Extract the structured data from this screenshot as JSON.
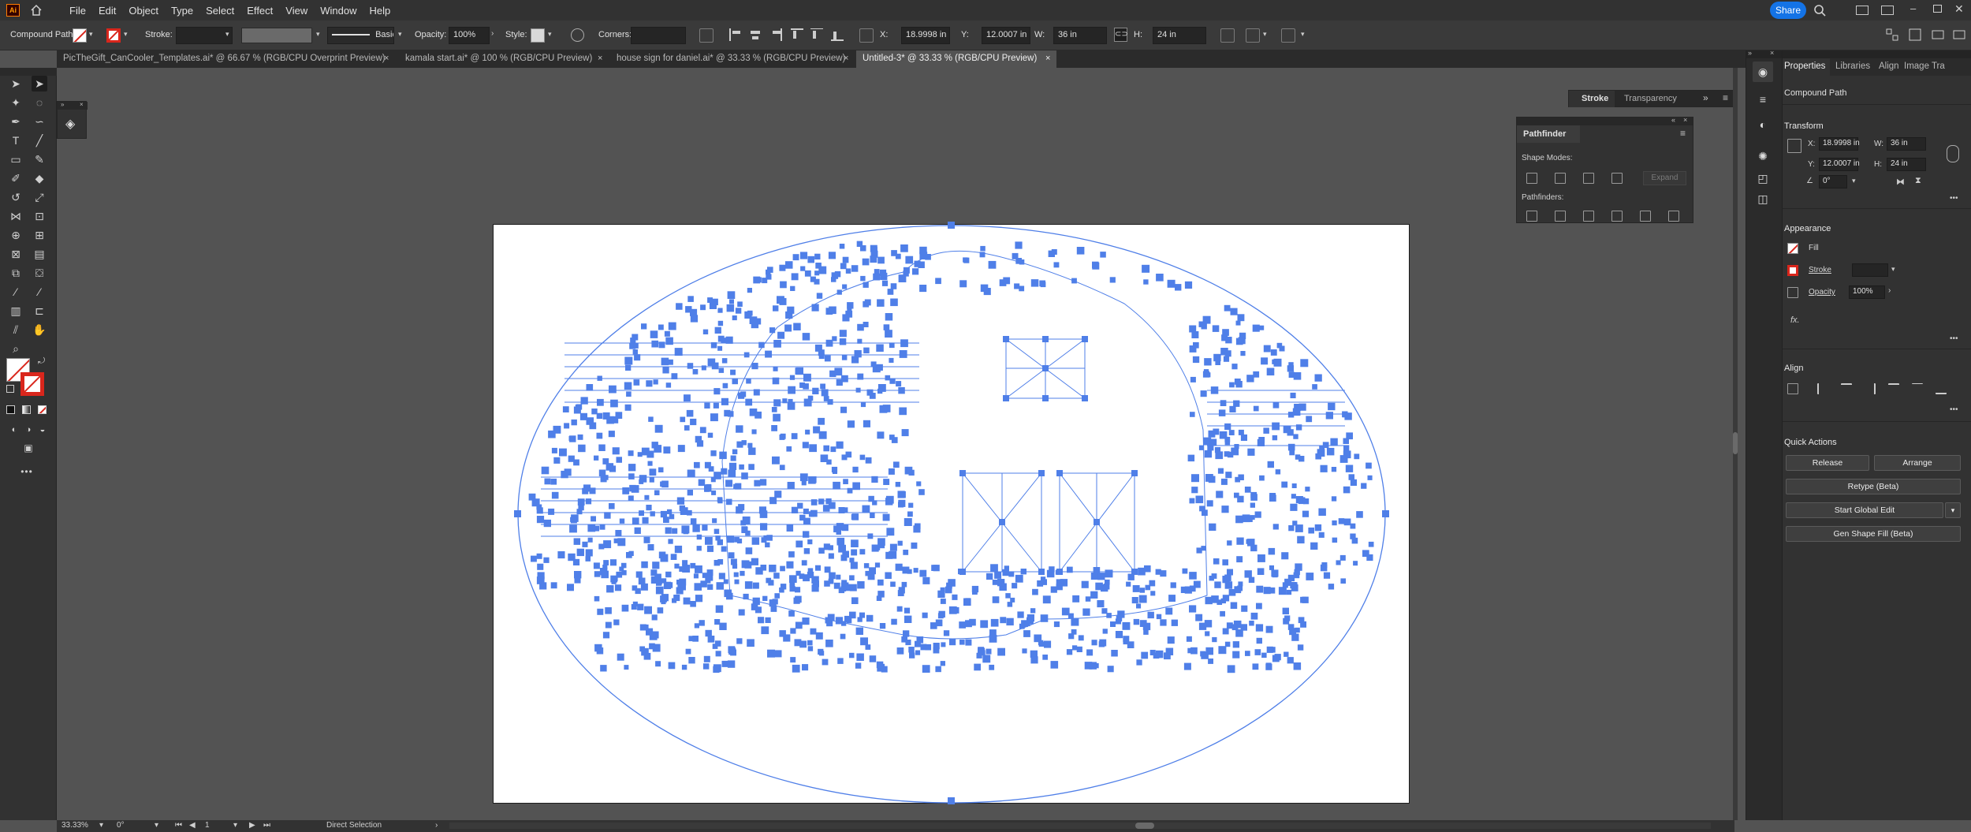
{
  "menubar": {
    "app_logo": "Ai",
    "items": [
      "File",
      "Edit",
      "Object",
      "Type",
      "Select",
      "Effect",
      "View",
      "Window",
      "Help"
    ],
    "share_label": "Share"
  },
  "controlbar": {
    "selection_type": "Compound Path",
    "stroke_label": "Stroke:",
    "brush_style": "Basic",
    "opacity_label": "Opacity:",
    "opacity_value": "100%",
    "style_label": "Style:",
    "corners_label": "Corners:",
    "x_label": "X:",
    "x_value": "18.9998 in",
    "y_label": "Y:",
    "y_value": "12.0007 in",
    "w_label": "W:",
    "w_value": "36 in",
    "h_label": "H:",
    "h_value": "24 in"
  },
  "tabs": [
    {
      "label": "PicTheGift_CanCooler_Templates.ai* @ 66.67 % (RGB/CPU Overprint Preview)",
      "active": false
    },
    {
      "label": "kamala start.ai* @ 100 % (RGB/CPU Preview)",
      "active": false
    },
    {
      "label": "house sign for daniel.ai* @ 33.33 % (RGB/CPU Preview)",
      "active": false
    },
    {
      "label": "Untitled-3* @ 33.33 % (RGB/CPU Preview)",
      "active": true
    }
  ],
  "stroke_panel": {
    "tab_stroke": "Stroke",
    "tab_transparency": "Transparency"
  },
  "pathfinder_panel": {
    "title": "Pathfinder",
    "shape_modes_label": "Shape Modes:",
    "expand_label": "Expand",
    "pathfinders_label": "Pathfinders:"
  },
  "properties": {
    "tabs": [
      "Properties",
      "Libraries",
      "Align",
      "Image Tra"
    ],
    "object_type": "Compound Path",
    "transform_title": "Transform",
    "x_label": "X:",
    "x_value": "18.9998 in",
    "y_label": "Y:",
    "y_value": "12.0007 in",
    "w_label": "W:",
    "w_value": "36 in",
    "h_label": "H:",
    "h_value": "24 in",
    "angle_value": "0°",
    "appearance_title": "Appearance",
    "fill_label": "Fill",
    "stroke_label": "Stroke",
    "opacity_label": "Opacity",
    "opacity_value": "100%",
    "fx_label": "fx.",
    "align_title": "Align",
    "quick_actions_title": "Quick Actions",
    "release_label": "Release",
    "arrange_label": "Arrange",
    "retype_label": "Retype (Beta)",
    "global_edit_label": "Start Global Edit",
    "gen_shape_fill_label": "Gen Shape Fill (Beta)"
  },
  "statusbar": {
    "zoom": "33.33%",
    "rotation": "0°",
    "artboard_number": "1",
    "tool_name": "Direct Selection"
  },
  "colors": {
    "selection_blue": "#4f7fe8",
    "fill_none_red": "#d9261c"
  }
}
